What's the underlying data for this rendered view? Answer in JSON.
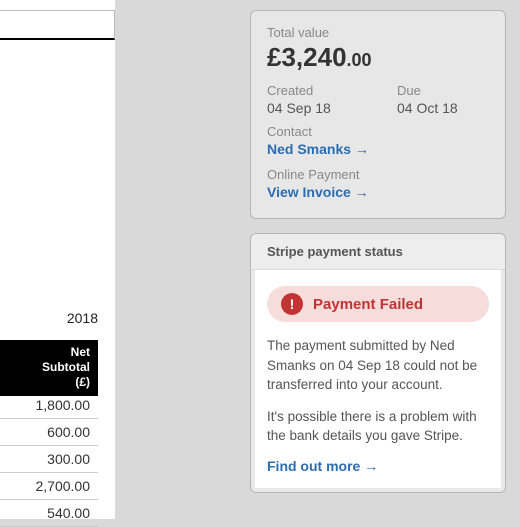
{
  "invoice_fragment": {
    "date": "2018",
    "column_header": "Net\nSubtotal\n(£)",
    "rows": [
      "1,800.00",
      "600.00",
      "300.00",
      "2,700.00",
      "540.00"
    ]
  },
  "summary": {
    "total_label": "Total value",
    "total_currency": "£",
    "total_main": "3,240",
    "total_cents": ".00",
    "created_label": "Created",
    "created_value": "04 Sep 18",
    "due_label": "Due",
    "due_value": "04 Oct 18",
    "contact_label": "Contact",
    "contact_value": "Ned Smanks",
    "online_label": "Online Payment",
    "online_link": "View Invoice"
  },
  "stripe": {
    "header": "Stripe payment status",
    "fail_title": "Payment Failed",
    "msg1": "The payment submitted by Ned Smanks on 04 Sep 18 could not be transferred into your account.",
    "msg2": "It's possible there is a problem with the bank details you gave Stripe.",
    "link": "Find out more"
  }
}
